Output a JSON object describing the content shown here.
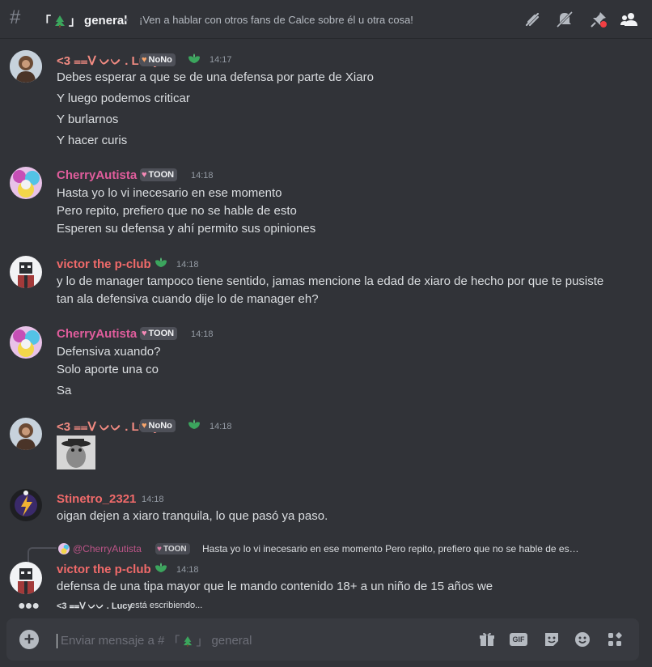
{
  "channel": {
    "prefix": "「",
    "suffix": "」",
    "name": "general",
    "topic": "¡Ven a hablar con otros fans de Calce sobre él u otra cosa!"
  },
  "messages": [
    {
      "author": "<3 ⩵ᐯ ᨆᨆ . Lucy",
      "author_color": "#f28b82",
      "badge": "NoNo",
      "time": "14:17",
      "lines": [
        "Debes esperar a que se de una defensa por parte de Xiaro",
        "Y luego podemos criticar",
        "Y burlarnos",
        "Y hacer curis"
      ]
    },
    {
      "author": "CherryAutista",
      "author_color": "#e05d9c",
      "badge": "TOON",
      "time": "14:18",
      "lines": [
        "Hasta yo lo vi inecesario en ese momento",
        "Pero repito, prefiero que no se hable de esto",
        "Esperen su defensa y ahí permito sus opiniones"
      ]
    },
    {
      "author": "victor the p-club",
      "author_color": "#f06a6a",
      "time": "14:18",
      "lines": [
        "y lo de manager tampoco tiene sentido, jamas mencione la edad de xiaro de hecho por que te pusiste",
        "tan ala defensiva cuando dije lo de manager eh?"
      ]
    },
    {
      "author": "CherryAutista",
      "author_color": "#e05d9c",
      "badge": "TOON",
      "time": "14:18",
      "lines": [
        "Defensiva xuando?",
        "Solo aporte una co",
        "Sa"
      ]
    },
    {
      "author": "<3 ⩵ᐯ ᨆᨆ . Lucy",
      "author_color": "#f28b82",
      "badge": "NoNo",
      "time": "14:18"
    },
    {
      "author": "Stinetro_2321",
      "author_color": "#f06a6a",
      "time": "14:18",
      "lines": [
        "oigan dejen a xiaro tranquila, lo que pasó ya paso."
      ]
    },
    {
      "reply": {
        "author": "@CherryAutista",
        "badge": "TOON",
        "text": "Hasta yo lo vi inecesario en ese momento Pero repito, prefiero que no se hable de es…"
      },
      "author": "victor the p-club",
      "author_color": "#f06a6a",
      "time": "14:18",
      "lines": [
        "defensa de una tipa mayor que le mando contenido 18+ a un niño de 15 años we"
      ]
    }
  ],
  "typing": {
    "user": "<3 ⩵ᐯ ᨆᨆ . Lucy",
    "text": "está escribiendo..."
  },
  "composer": {
    "placeholder_prefix": "Enviar mensaje a #",
    "channel_prefix": "「",
    "channel_suffix": "」",
    "channel_name": "general"
  },
  "colors": {
    "background": "#313338",
    "composer": "#383a40",
    "badge_bg": "#4e5058",
    "leaf_green": "#3ba55d"
  },
  "icons": [
    "hashtag-icon",
    "threads-icon",
    "mute-icon",
    "pin-icon",
    "members-icon",
    "add-icon",
    "gift-icon",
    "gif-icon",
    "sticker-icon",
    "emoji-icon",
    "apps-icon"
  ]
}
